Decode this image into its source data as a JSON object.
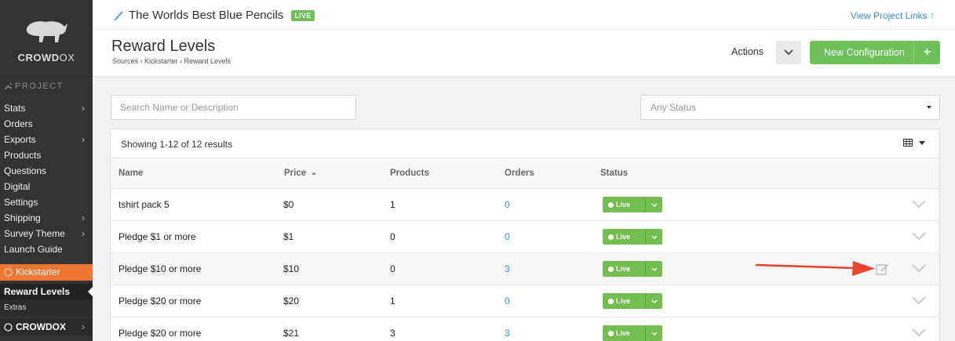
{
  "brand": {
    "name_bold": "CROWD",
    "name_thin": "OX",
    "name_bold2": ""
  },
  "sidebar": {
    "section_label": "PROJECT",
    "items": [
      {
        "label": "Stats",
        "has_submenu": true
      },
      {
        "label": "Orders",
        "has_submenu": false
      },
      {
        "label": "Exports",
        "has_submenu": true
      },
      {
        "label": "Products",
        "has_submenu": false
      },
      {
        "label": "Questions",
        "has_submenu": false
      },
      {
        "label": "Digital",
        "has_submenu": false
      },
      {
        "label": "Settings",
        "has_submenu": false
      },
      {
        "label": "Shipping",
        "has_submenu": true
      },
      {
        "label": "Survey Theme",
        "has_submenu": true
      },
      {
        "label": "Launch Guide",
        "has_submenu": false
      }
    ],
    "source_label": "Kickstarter",
    "source_items": [
      {
        "label": "Reward Levels",
        "active": true
      },
      {
        "label": "Extras",
        "active": false
      }
    ],
    "footer_brand": "CROWDOX"
  },
  "topbar": {
    "project_name": "The Worlds Best Blue Pencils",
    "live_badge": "LIVE",
    "view_links": "View Project Links ↑"
  },
  "header": {
    "title": "Reward Levels",
    "breadcrumb": "Sources  ›  Kickstarter  ›  Reward Levels",
    "actions_label": "Actions",
    "new_config_label": "New Configuration",
    "new_config_plus": "+"
  },
  "filters": {
    "search_placeholder": "Search Name or Description",
    "status_placeholder": "Any Status"
  },
  "table": {
    "results_text": "Showing 1-12 of 12 results",
    "columns": [
      "Name",
      "Price",
      "Products",
      "Orders",
      "Status"
    ],
    "sorted_column": "Price",
    "rows": [
      {
        "name": "tshirt pack 5",
        "price": "$0",
        "products": "1",
        "orders": "0",
        "status": "Live"
      },
      {
        "name": "Pledge $1 or more",
        "price": "$1",
        "products": "0",
        "orders": "0",
        "status": "Live"
      },
      {
        "name": "Pledge $10 or more",
        "price": "$10",
        "products": "0",
        "orders": "3",
        "status": "Live"
      },
      {
        "name": "Pledge $20 or more",
        "price": "$20",
        "products": "1",
        "orders": "0",
        "status": "Live"
      },
      {
        "name": "Pledge $20 or more",
        "price": "$21",
        "products": "3",
        "orders": "3",
        "status": "Live"
      }
    ]
  },
  "colors": {
    "sidebar_bg": "#333333",
    "accent_orange": "#f07633",
    "accent_green": "#6fc05a",
    "link_blue": "#3a8fd0",
    "annotation_red": "#e8442e"
  }
}
